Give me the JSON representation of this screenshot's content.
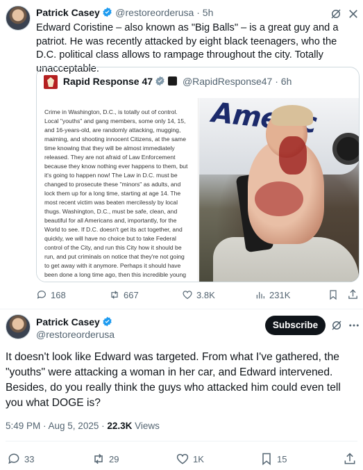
{
  "post1": {
    "author_name": "Patrick Casey",
    "handle_time": "@restoreorderusa · 5h",
    "text": "Edward Coristine – also known as \"Big Balls\" – is a great guy and a patriot. He was recently attacked by eight black teenagers, who the D.C. political class allows to rampage throughout the city. Totally unacceptable.",
    "quote": {
      "author_name": "Rapid Response 47",
      "handle_time": "@RapidResponse47 · 6h",
      "doc_text": "Crime in Washington, D.C., is totally out of control. Local \"youths\" and gang members, some only 14, 15, and 16-years-old, are randomly attacking, mugging, maiming, and shooting innocent Citizens, at the same time knowing that they will be almost immediately released. They are not afraid of Law Enforcement because they know nothing ever happens to them, but it's going to happen now! The Law in D.C. must be changed to prosecute these \"minors\" as adults, and lock them up for a long time, starting at age 14. The most recent victim was beaten mercilessly by local thugs. Washington, D.C., must be safe, clean, and beautiful for all Americans and, importantly, for the World to see. If D.C. doesn't get its act together, and quickly, we will have no choice but to take Federal control of the City, and run this City how it should be run, and put criminals on notice that they're not going to get away with it anymore. Perhaps it should have been done a long time ago, then this incredible young man, and so many others, would not have had to go through the horrors of Violent Crime. If this continues, I am going to exert my powers, and FEDERALIZE this",
      "photo_text": "Americ"
    },
    "stats": {
      "replies": "168",
      "reposts": "667",
      "likes": "3.8K",
      "views": "231K"
    }
  },
  "post2": {
    "author_name": "Patrick Casey",
    "handle": "@restoreorderusa",
    "subscribe_label": "Subscribe",
    "text": "It doesn't look like Edward was targeted. From what I've gathered, the \"youths\" were attacking a woman in her car, and Edward intervened. Besides, do you really think the guys who attacked him could even tell you what DOGE is?",
    "time": "5:49 PM · Aug 5, 2025 · ",
    "views_count": "22.3K",
    "views_label": " Views",
    "stats": {
      "replies": "33",
      "reposts": "29",
      "likes": "1K",
      "bookmarks": "15"
    }
  },
  "colors": {
    "verified": "#1d9bf0",
    "text": "#0f1419",
    "muted": "#536471"
  }
}
